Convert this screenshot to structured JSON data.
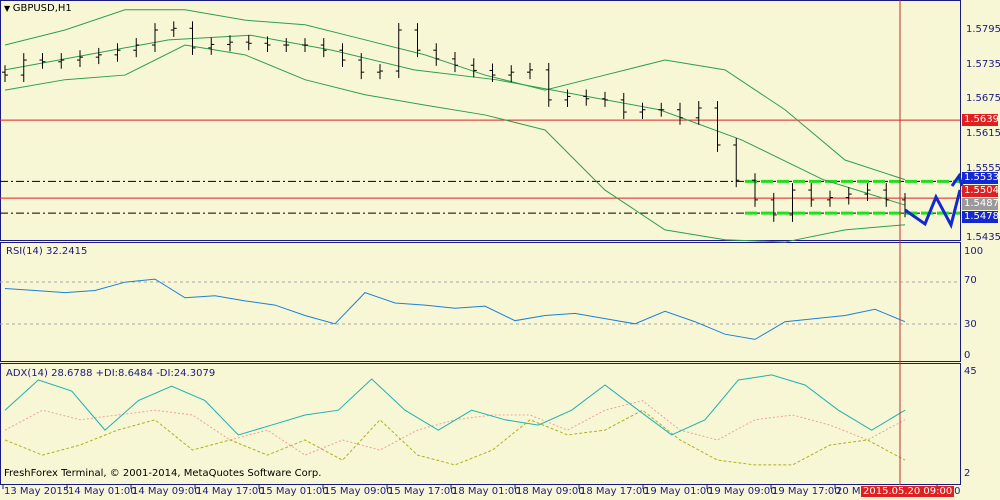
{
  "header": {
    "symbol": "GBPUSD,H1"
  },
  "rsi": {
    "label": "RSI(14) 32.2415",
    "ticks": [
      "100",
      "70",
      "30",
      "0"
    ]
  },
  "adx": {
    "label": "ADX(14) 28.6788 +DI:8.6484 -DI:24.3079",
    "ticks": [
      "45",
      "2"
    ]
  },
  "copyright": "FreshForex Terminal, © 2001-2014, MetaQuotes Software Corp.",
  "price_ticks": [
    "1.5795",
    "1.5735",
    "1.5675",
    "1.5615",
    "1.5555",
    "1.5435"
  ],
  "price_tags": {
    "r1": "1.5639",
    "r2": "1.5504",
    "res": "1.5533",
    "sup": "1.5478",
    "hidden": "1.5487"
  },
  "time_labels": [
    "13 May 2015",
    "14 May 01:00",
    "14 May 09:00",
    "14 May 17:00",
    "15 May 01:00",
    "15 May 09:00",
    "15 May 17:00",
    "18 May 01:00",
    "18 May 09:00",
    "18 May 17:00",
    "19 May 01:00",
    "19 May 09:00",
    "19 May 17:00",
    "20 Ma",
    "9:00"
  ],
  "cursor_time": "2015.05.20 09:00",
  "colors": {
    "bg": "#f7f7d5",
    "axis": "#1a1a80",
    "band": "#2e9e4e",
    "red": "#e02020",
    "blue": "#1428d0",
    "green": "#22dd22"
  },
  "chart_data": {
    "type": "ohlc",
    "title": "GBPUSD,H1",
    "ylim": [
      1.5425,
      1.5835
    ],
    "closes": [
      1.5717,
      1.5743,
      1.574,
      1.5743,
      1.5748,
      1.5752,
      1.576,
      1.5769,
      1.5795,
      1.5798,
      1.5764,
      1.577,
      1.5774,
      1.5772,
      1.5769,
      1.5769,
      1.5769,
      1.576,
      1.5743,
      1.5722,
      1.5724,
      1.5795,
      1.576,
      1.5745,
      1.5734,
      1.5725,
      1.5717,
      1.5722,
      1.5726,
      1.5674,
      1.568,
      1.5676,
      1.5674,
      1.5653,
      1.5657,
      1.5657,
      1.5643,
      1.566,
      1.5596,
      1.5535,
      1.5501,
      1.5475,
      1.5518,
      1.5501,
      1.5505,
      1.5511,
      1.5518,
      1.5501,
      1.5483
    ],
    "bands": {
      "upper": [
        1.5769,
        1.5795,
        1.583,
        1.583,
        1.5812,
        1.5804,
        1.5778,
        1.5752,
        1.5717,
        1.5691,
        1.5717,
        1.5743,
        1.5726,
        1.5657,
        1.557,
        1.5536
      ],
      "lower": [
        1.5691,
        1.5709,
        1.5717,
        1.5769,
        1.5752,
        1.5709,
        1.5683,
        1.5665,
        1.5648,
        1.5622,
        1.5518,
        1.5449,
        1.5432,
        1.5428,
        1.5449,
        1.5458
      ],
      "middle": [
        1.5726,
        1.5752,
        1.5778,
        1.5786,
        1.576,
        1.5726,
        1.5709,
        1.5683,
        1.5657,
        1.5605,
        1.5536,
        1.5492
      ]
    },
    "levels": {
      "red": [
        1.5639,
        1.5504
      ],
      "dashed": [
        1.5533,
        1.5478
      ]
    },
    "rsi": [
      64,
      62,
      60,
      62,
      70,
      73,
      55,
      57,
      52,
      48,
      38,
      30,
      60,
      50,
      48,
      45,
      47,
      33,
      38,
      40,
      35,
      30,
      42,
      32,
      20,
      15,
      32,
      35,
      38,
      44,
      32
    ],
    "adx": [
      29,
      41.6,
      37,
      20.7,
      33,
      39,
      33,
      18.7,
      22.8,
      27,
      29,
      42,
      29,
      20.7,
      29,
      25,
      22.8,
      29,
      39.5,
      29,
      18.7,
      25,
      41.6,
      43.7,
      39.5,
      29,
      20.7,
      29
    ],
    "plus_di": [
      16.6,
      10.3,
      14.5,
      20.7,
      25,
      12.4,
      16.6,
      10.3,
      16.6,
      8.2,
      25,
      10.3,
      6.2,
      12.4,
      25,
      18.7,
      20.7,
      29,
      16.6,
      8.2,
      6.2,
      6.2,
      14.5,
      16.6,
      8.2
    ],
    "minus_di": [
      20.7,
      29,
      25,
      27,
      29,
      27,
      16.6,
      20.7,
      10.3,
      16.6,
      12.4,
      20.7,
      25,
      27,
      27,
      20.7,
      29,
      33,
      20.7,
      16.6,
      25,
      27,
      22.8,
      16.6,
      25
    ]
  }
}
